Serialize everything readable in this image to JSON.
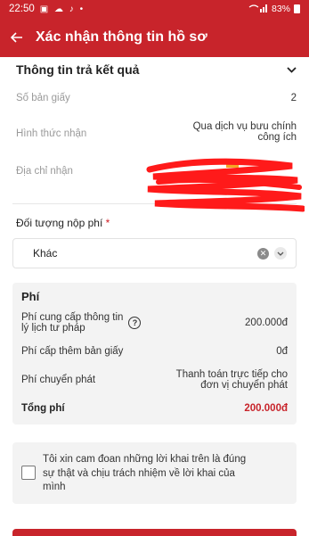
{
  "status_bar": {
    "time": "22:50",
    "left_icons": "▣ ☁ ♪ •",
    "battery": "83%"
  },
  "header": {
    "back_icon": "arrow-left-icon",
    "title": "Xác nhận thông tin hồ sơ"
  },
  "result_section": {
    "title": "Thông tin trả kết quả",
    "rows": [
      {
        "label": "Số bản giấy",
        "value": "2"
      },
      {
        "label": "Hình thức nhận",
        "value_line1": "Qua dịch vụ bưu chính",
        "value_line2": "công ích"
      },
      {
        "label": "Địa chỉ nhận",
        "value": ""
      }
    ]
  },
  "fee_payer": {
    "label": "Đối tượng nộp phí",
    "required_mark": "*",
    "selected": "Khác"
  },
  "fees": {
    "title": "Phí",
    "items": [
      {
        "label_line1": "Phí cung cấp thông tin",
        "label_line2": "lý lịch tư pháp",
        "value": "200.000đ"
      },
      {
        "label": "Phí cấp thêm bản giấy",
        "value": "0đ"
      },
      {
        "label": "Phí chuyển phát",
        "value_line1": "Thanh toán trực tiếp cho",
        "value_line2": "đơn vị chuyển phát"
      }
    ],
    "total_label": "Tổng phí",
    "total_value": "200.000đ"
  },
  "commitment": {
    "line1": "Tôi xin cam đoan những lời khai trên là đúng",
    "line2": "sự thật và chịu trách nhiệm về lời khai của",
    "line3": "mình"
  },
  "colors": {
    "brand_red": "#c8242b",
    "total_red": "#c8242b",
    "panel_gray": "#f3f3f3"
  }
}
